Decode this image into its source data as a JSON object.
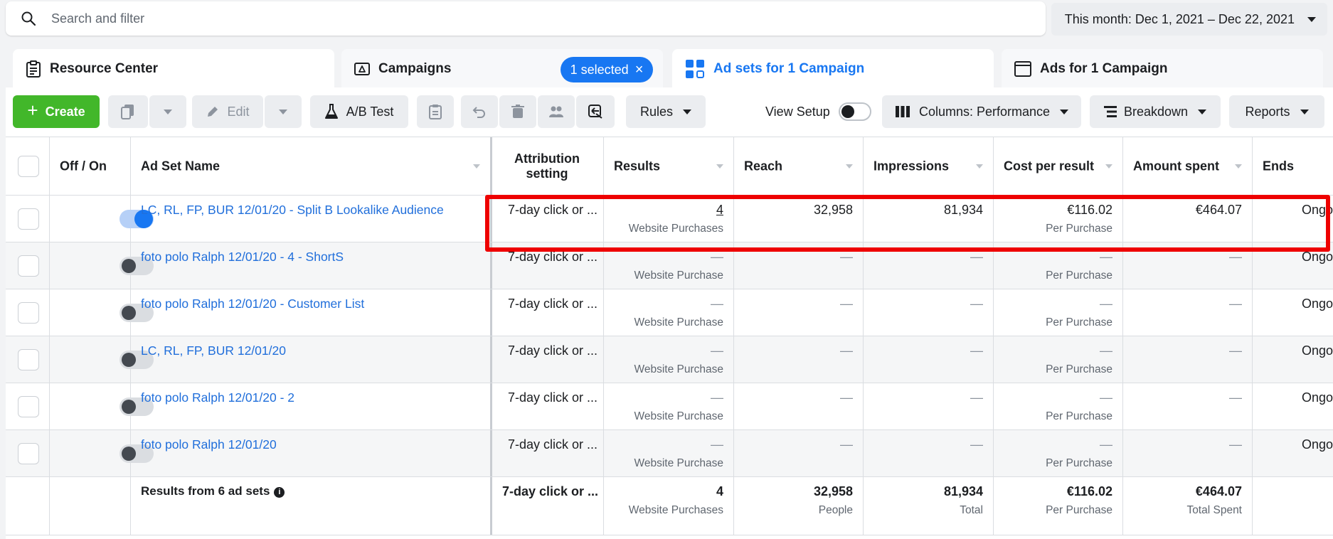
{
  "search": {
    "placeholder": "Search and filter"
  },
  "date_range": {
    "label": "This month: Dec 1, 2021 – Dec 22, 2021"
  },
  "tabs": {
    "resource": "Resource Center",
    "campaigns": "Campaigns",
    "selected_pill": "1 selected",
    "adsets": "Ad sets for 1 Campaign",
    "ads": "Ads for 1 Campaign"
  },
  "toolbar": {
    "create": "Create",
    "edit": "Edit",
    "ab_test": "A/B Test",
    "rules": "Rules",
    "view_setup": "View Setup",
    "columns": "Columns: Performance",
    "breakdown": "Breakdown",
    "reports": "Reports"
  },
  "columns": {
    "off_on": "Off / On",
    "name": "Ad Set Name",
    "attribution": "Attribution setting",
    "results": "Results",
    "reach": "Reach",
    "impressions": "Impressions",
    "cost": "Cost per result",
    "spent": "Amount spent",
    "ends": "Ends"
  },
  "rows": [
    {
      "name": "LC, RL, FP, BUR 12/01/20 - Split B Lookalike Audience",
      "on": true,
      "attribution": "7-day click or ...",
      "results": "4",
      "results_sub": "Website Purchases",
      "reach": "32,958",
      "impressions": "81,934",
      "cost": "€116.02",
      "cost_sub": "Per Purchase",
      "spent": "€464.07",
      "ends": "Ongo"
    },
    {
      "name": "foto polo Ralph 12/01/20 - 4 - ShortS",
      "on": false,
      "attribution": "7-day click or ...",
      "results": "—",
      "results_sub": "Website Purchase",
      "reach": "—",
      "impressions": "—",
      "cost": "—",
      "cost_sub": "Per Purchase",
      "spent": "—",
      "ends": "Ongo"
    },
    {
      "name": "foto polo Ralph 12/01/20 - Customer List",
      "on": false,
      "attribution": "7-day click or ...",
      "results": "—",
      "results_sub": "Website Purchase",
      "reach": "—",
      "impressions": "—",
      "cost": "—",
      "cost_sub": "Per Purchase",
      "spent": "—",
      "ends": "Ongo"
    },
    {
      "name": "LC, RL, FP, BUR 12/01/20",
      "on": false,
      "attribution": "7-day click or ...",
      "results": "—",
      "results_sub": "Website Purchase",
      "reach": "—",
      "impressions": "—",
      "cost": "—",
      "cost_sub": "Per Purchase",
      "spent": "—",
      "ends": "Ongo"
    },
    {
      "name": "foto polo Ralph 12/01/20 - 2",
      "on": false,
      "attribution": "7-day click or ...",
      "results": "—",
      "results_sub": "Website Purchase",
      "reach": "—",
      "impressions": "—",
      "cost": "—",
      "cost_sub": "Per Purchase",
      "spent": "—",
      "ends": "Ongo"
    },
    {
      "name": "foto polo Ralph 12/01/20",
      "on": false,
      "attribution": "7-day click or ...",
      "results": "—",
      "results_sub": "Website Purchase",
      "reach": "—",
      "impressions": "—",
      "cost": "—",
      "cost_sub": "Per Purchase",
      "spent": "—",
      "ends": "Ongo"
    }
  ],
  "summary": {
    "label": "Results from 6 ad sets",
    "attribution": "7-day click or ...",
    "results": "4",
    "results_sub": "Website Purchases",
    "reach": "32,958",
    "reach_sub": "People",
    "impressions": "81,934",
    "impressions_sub": "Total",
    "cost": "€116.02",
    "cost_sub": "Per Purchase",
    "spent": "€464.07",
    "spent_sub": "Total Spent"
  },
  "colors": {
    "accent": "#1877f2",
    "create": "#42b72a",
    "highlight": "#ee0000",
    "link": "#216fdb"
  }
}
